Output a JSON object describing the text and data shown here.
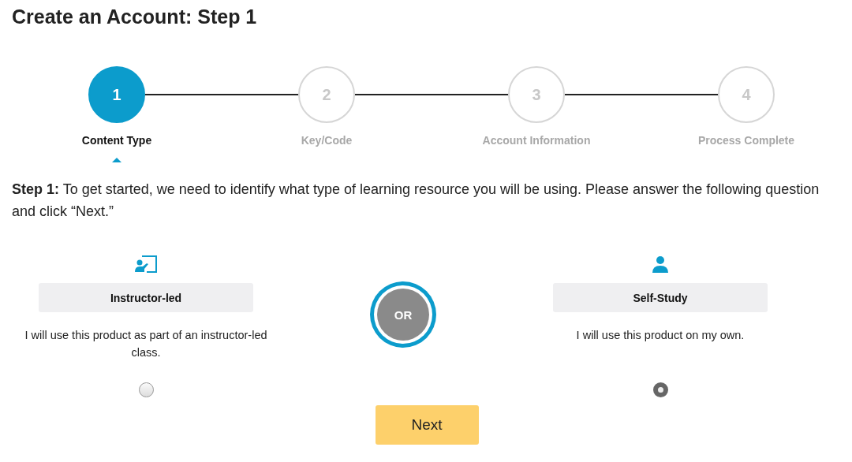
{
  "title": "Create an Account: Step 1",
  "steps": [
    {
      "number": "1",
      "label": "Content Type",
      "selected": true
    },
    {
      "number": "2",
      "label": "Key/Code",
      "selected": false
    },
    {
      "number": "3",
      "label": "Account Information",
      "selected": false
    },
    {
      "number": "4",
      "label": "Process Complete",
      "selected": false
    }
  ],
  "instruction": "**Step 1:** To get started, we need to identify what type of learning resource you will be using. Please answer the following question and click “Next.”",
  "options": [
    {
      "kind": "instructor",
      "label": "Instructor-led",
      "description": "I will use this product as part of an instructor-led class.",
      "selected": false
    },
    {
      "kind": "self",
      "label": "Self-Study",
      "description": "I will use this product on my own.",
      "selected": true
    }
  ],
  "separator": "OR",
  "next_button": "Next"
}
